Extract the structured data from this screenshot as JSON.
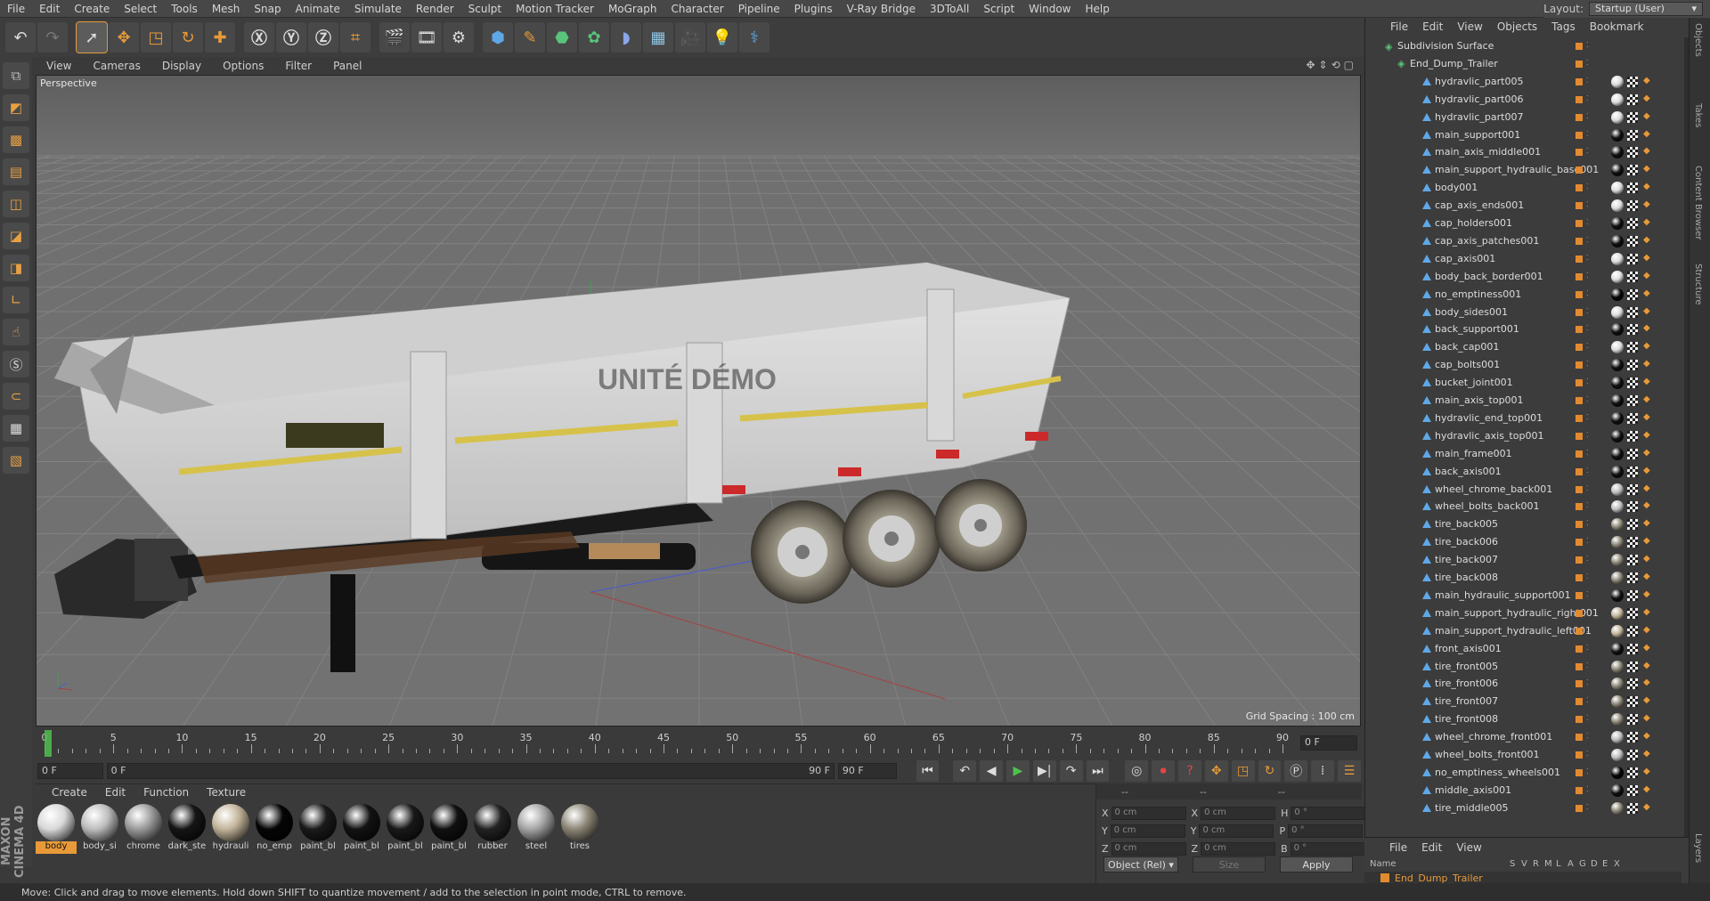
{
  "menubar": {
    "items": [
      "File",
      "Edit",
      "Create",
      "Select",
      "Tools",
      "Mesh",
      "Snap",
      "Animate",
      "Simulate",
      "Render",
      "Sculpt",
      "Motion Tracker",
      "MoGraph",
      "Character",
      "Pipeline",
      "Plugins",
      "V-Ray Bridge",
      "3DToAll",
      "Script",
      "Window",
      "Help"
    ],
    "layout_label": "Layout:",
    "layout_value": "Startup (User)"
  },
  "viewport": {
    "menu": [
      "View",
      "Cameras",
      "Display",
      "Options",
      "Filter",
      "Panel"
    ],
    "label": "Perspective",
    "grid_spacing": "Grid Spacing : 100 cm",
    "decal_text": "UNITÉ DÉMO"
  },
  "timeline": {
    "ticks": [
      "0",
      "5",
      "10",
      "15",
      "20",
      "25",
      "30",
      "35",
      "40",
      "45",
      "50",
      "55",
      "60",
      "65",
      "70",
      "75",
      "80",
      "85",
      "90"
    ],
    "current_frame": "0 F"
  },
  "transport": {
    "start": "0 F",
    "slider_left": "0 F",
    "slider_right": "90 F",
    "end": "90 F"
  },
  "materials": {
    "menu": [
      "Create",
      "Edit",
      "Function",
      "Texture"
    ],
    "items": [
      {
        "label": "body",
        "color": "#d8d8d8",
        "selected": true
      },
      {
        "label": "body_si",
        "color": "#bdbdbd",
        "selected": false
      },
      {
        "label": "chrome",
        "color": "#9a9a9a",
        "selected": false
      },
      {
        "label": "dark_ste",
        "color": "#151515",
        "selected": false
      },
      {
        "label": "hydrauli",
        "color": "#c2b49a",
        "selected": false
      },
      {
        "label": "no_emp",
        "color": "#050505",
        "selected": false
      },
      {
        "label": "paint_bl",
        "color": "#1a1a1a",
        "selected": false
      },
      {
        "label": "paint_bl",
        "color": "#121212",
        "selected": false
      },
      {
        "label": "paint_bl",
        "color": "#181818",
        "selected": false
      },
      {
        "label": "paint_bl",
        "color": "#101010",
        "selected": false
      },
      {
        "label": "rubber",
        "color": "#222222",
        "selected": false
      },
      {
        "label": "steel",
        "color": "#a4a4a4",
        "selected": false
      },
      {
        "label": "tires",
        "color": "#8c8676",
        "selected": false
      }
    ]
  },
  "attributes": {
    "header": [
      "--",
      "--",
      "--"
    ],
    "rows": [
      {
        "a": "X",
        "av": "0 cm",
        "b": "X",
        "bv": "0 cm",
        "c": "H",
        "cv": "0 °"
      },
      {
        "a": "Y",
        "av": "0 cm",
        "b": "Y",
        "bv": "0 cm",
        "c": "P",
        "cv": "0 °"
      },
      {
        "a": "Z",
        "av": "0 cm",
        "b": "Z",
        "bv": "0 cm",
        "c": "B",
        "cv": "0 °"
      }
    ],
    "coord_mode": "Object (Rel) ▾",
    "size_mode": "Size",
    "apply": "Apply"
  },
  "status": "Move: Click and drag to move elements. Hold down SHIFT to quantize movement / add to the selection in point mode, CTRL to remove.",
  "object_manager": {
    "menu": [
      "File",
      "Edit",
      "View",
      "Objects",
      "Tags",
      "Bookmark"
    ],
    "root": "Subdivision Surface",
    "parent": "End_Dump_Trailer",
    "children": [
      "hydravlic_part005",
      "hydravlic_part006",
      "hydravlic_part007",
      "main_support001",
      "main_axis_middle001",
      "main_support_hydraulic_base001",
      "body001",
      "cap_axis_ends001",
      "cap_holders001",
      "cap_axis_patches001",
      "cap_axis001",
      "body_back_border001",
      "no_emptiness001",
      "body_sides001",
      "back_support001",
      "back_cap001",
      "cap_bolts001",
      "bucket_joint001",
      "main_axis_top001",
      "hydravlic_end_top001",
      "hydravlic_axis_top001",
      "main_frame001",
      "back_axis001",
      "wheel_chrome_back001",
      "wheel_bolts_back001",
      "tire_back005",
      "tire_back006",
      "tire_back007",
      "tire_back008",
      "main_hydraulic_support001",
      "main_support_hydraulic_right001",
      "main_support_hydraulic_left001",
      "front_axis001",
      "tire_front005",
      "tire_front006",
      "tire_front007",
      "tire_front008",
      "wheel_chrome_front001",
      "wheel_bolts_front001",
      "no_emptiness_wheels001",
      "middle_axis001",
      "tire_middle005"
    ],
    "tag_colors": [
      "#dcdcdc",
      "#dcdcdc",
      "#dcdcdc",
      "#101010",
      "#101010",
      "#101010",
      "#dcdcdc",
      "#dcdcdc",
      "#101010",
      "#101010",
      "#dcdcdc",
      "#dcdcdc",
      "#050505",
      "#dcdcdc",
      "#101010",
      "#dcdcdc",
      "#101010",
      "#101010",
      "#101010",
      "#101010",
      "#101010",
      "#101010",
      "#101010",
      "#bdbdbd",
      "#bdbdbd",
      "#8c8676",
      "#8c8676",
      "#8c8676",
      "#8c8676",
      "#101010",
      "#c2b49a",
      "#c2b49a",
      "#101010",
      "#8c8676",
      "#8c8676",
      "#8c8676",
      "#8c8676",
      "#bdbdbd",
      "#bdbdbd",
      "#050505",
      "#101010",
      "#8c8676"
    ]
  },
  "layers": {
    "menu": [
      "File",
      "Edit",
      "View"
    ],
    "columns": [
      "Name",
      "S",
      "V",
      "R",
      "M",
      "L",
      "A",
      "G",
      "D",
      "E",
      "X"
    ],
    "row_name": "End_Dump_Trailer"
  },
  "side_tabs": [
    "Objects",
    "Takes",
    "Content Browser",
    "Structure",
    "Layers"
  ]
}
